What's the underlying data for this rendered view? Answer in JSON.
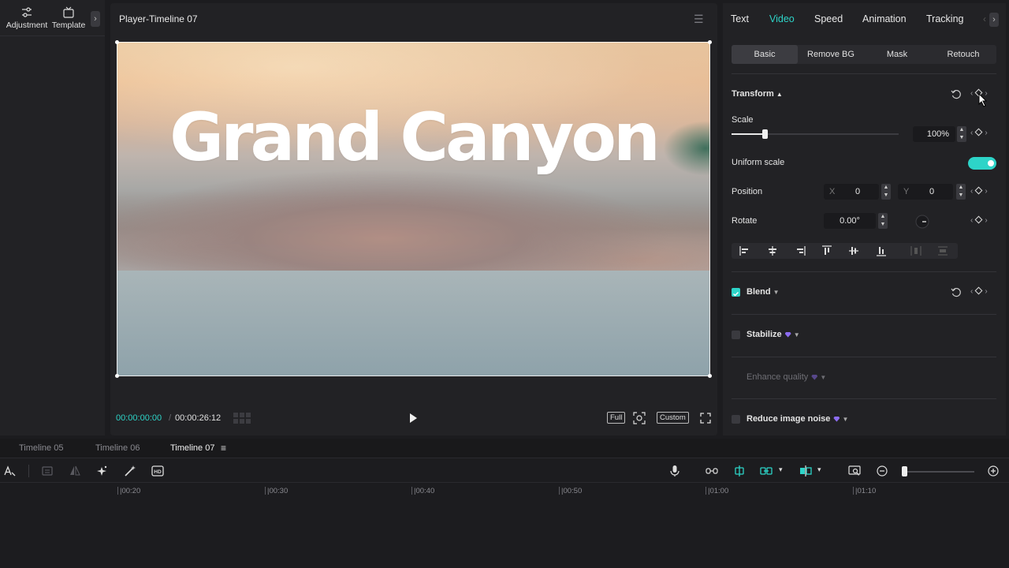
{
  "left_panel": {
    "tabs": [
      {
        "label": "Adjustment",
        "icon": "sliders-icon"
      },
      {
        "label": "Template",
        "icon": "template-icon"
      }
    ],
    "more_icon": "chevron-right-icon"
  },
  "player": {
    "title": "Player-Timeline 07",
    "canvas_title": "Grand Canyon",
    "time_current": "00:00:00:00",
    "time_separator": "/",
    "time_total": "00:00:26:12",
    "buttons": {
      "full": "Full",
      "custom": "Custom"
    }
  },
  "right_panel": {
    "tabs": [
      {
        "label": "Text",
        "active": false
      },
      {
        "label": "Video",
        "active": true
      },
      {
        "label": "Speed",
        "active": false
      },
      {
        "label": "Animation",
        "active": false
      },
      {
        "label": "Tracking",
        "active": false
      }
    ],
    "subtabs": [
      {
        "label": "Basic",
        "active": true
      },
      {
        "label": "Remove BG",
        "active": false
      },
      {
        "label": "Mask",
        "active": false
      },
      {
        "label": "Retouch",
        "active": false
      }
    ],
    "transform": {
      "heading": "Transform",
      "scale_label": "Scale",
      "scale_value": "100%",
      "scale_fraction": 0.2,
      "uniform_scale_label": "Uniform scale",
      "uniform_scale_on": true,
      "position_label": "Position",
      "x_label": "X",
      "x_value": "0",
      "y_label": "Y",
      "y_value": "0",
      "rotate_label": "Rotate",
      "rotate_value": "0.00°"
    },
    "blend": {
      "label": "Blend",
      "checked": true
    },
    "stabilize": {
      "label": "Stabilize",
      "checked": false
    },
    "enhance": {
      "label": "Enhance quality",
      "enabled": false
    },
    "reduce_noise": {
      "label": "Reduce image noise",
      "checked": false
    }
  },
  "timeline": {
    "tabs": [
      {
        "label": "Timeline 05",
        "active": false
      },
      {
        "label": "Timeline 06",
        "active": false
      },
      {
        "label": "Timeline 07",
        "active": true
      }
    ],
    "ruler": [
      "|00:20",
      "|00:30",
      "|00:40",
      "|00:50",
      "|01:00",
      "|01:10"
    ],
    "zoom_fraction": 0.02
  },
  "colors": {
    "accent": "#2dd4c8",
    "background": "#1c1c1f",
    "panel": "#222225"
  }
}
